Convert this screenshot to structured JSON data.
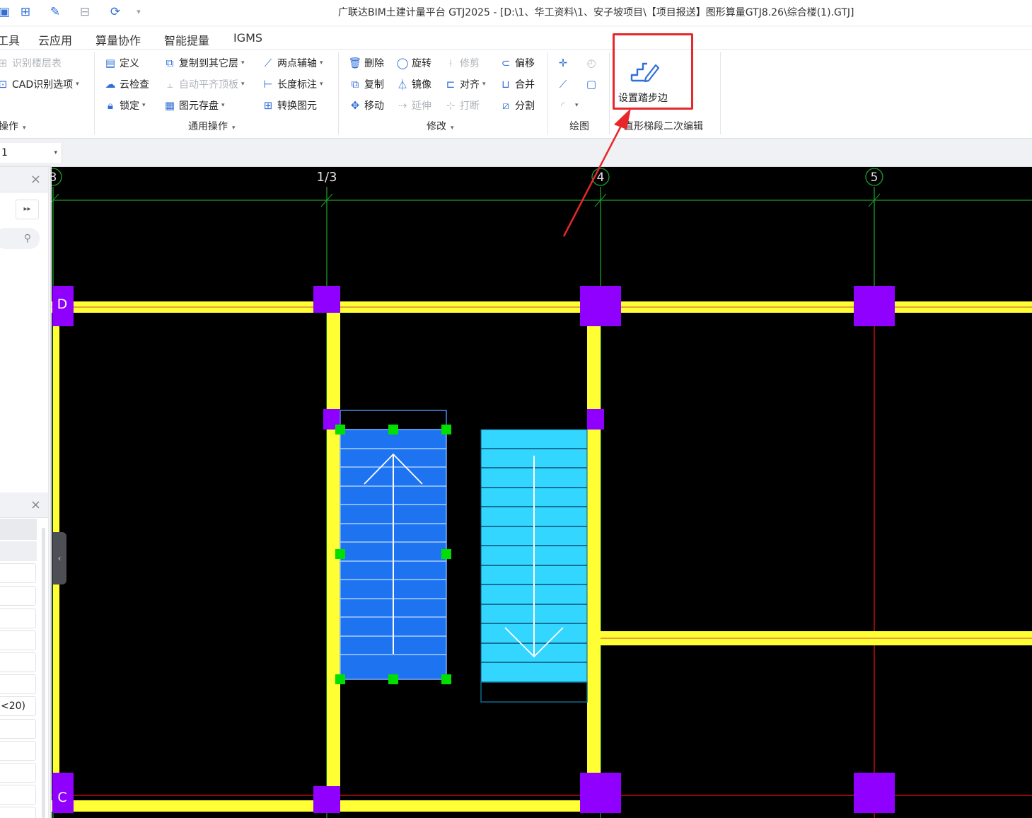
{
  "titlebar": {
    "title": "广联达BIM土建计量平台 GTJ2025 - [D:\\1、华工资料\\1、安子坡项目\\【项目报送】图形算量GTJ8.26\\综合楼(1).GTJ]",
    "quick_icons": [
      "save-icon",
      "layout-icon",
      "edit-icon",
      "ruler-icon",
      "sync-icon",
      "customize-dropdown-icon"
    ]
  },
  "menu": {
    "tabs": [
      "工具",
      "云应用",
      "算量协作",
      "智能提量",
      "IGMS"
    ]
  },
  "ribbon": {
    "ops_group": {
      "items": [
        "识别楼层表",
        "CAD识别选项"
      ],
      "label": "操作"
    },
    "general_group": {
      "define": "定义",
      "cloud_check": "云检查",
      "lock": "锁定",
      "copy_to_floor": "复制到其它层",
      "auto_align_slab": "自动平齐顶板",
      "element_store": "图元存盘",
      "two_point_axis": "两点辅轴",
      "length_mark": "长度标注",
      "convert_element": "转换图元",
      "label": "通用操作"
    },
    "modify_group": {
      "delete": "删除",
      "rotate": "旋转",
      "trim": "修剪",
      "offset": "偏移",
      "copy": "复制",
      "mirror": "镜像",
      "align": "对齐",
      "merge": "合并",
      "move": "移动",
      "extend": "延伸",
      "break": "打断",
      "split": "分割",
      "label": "修改"
    },
    "draw_group": {
      "label": "绘图"
    },
    "stair_group": {
      "set_step_edge": "设置踏步边",
      "label": "直形梯段二次编辑"
    }
  },
  "layerbar": {
    "floor_value": "1"
  },
  "leftpanel": {
    "field_value": "<20)"
  },
  "canvas": {
    "axis_labels": [
      "3",
      "1/3",
      "4",
      "5"
    ],
    "row_labels": [
      "D",
      "C"
    ],
    "colors": {
      "background": "#000000",
      "wall": "#ffff33",
      "column": "#8f00ff",
      "stair_up": "#1e74f0",
      "stair_down": "#33d6ff",
      "grid_green": "#1a9e2a",
      "grid_red": "#e01010",
      "grip": "#00e000"
    }
  },
  "annotation": {
    "color": "#e8272a"
  }
}
